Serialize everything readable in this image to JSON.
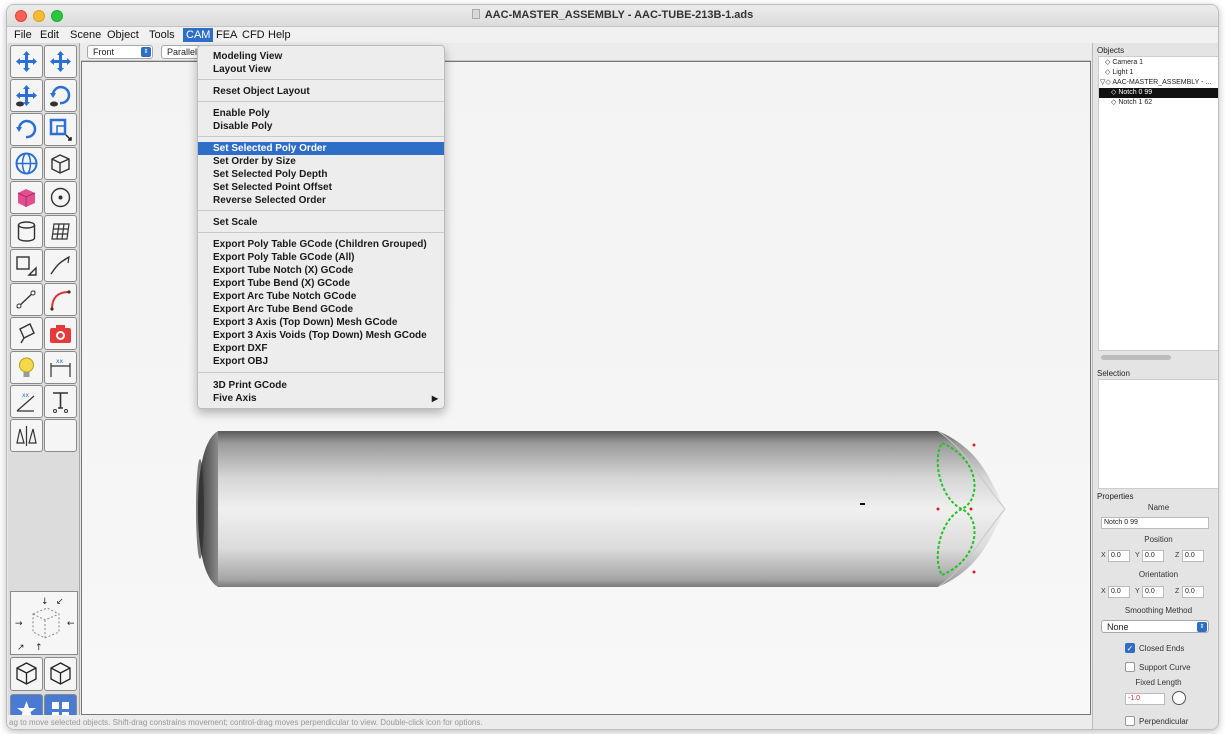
{
  "window": {
    "title": "AAC-MASTER_ASSEMBLY - AAC-TUBE-213B-1.ads"
  },
  "menubar": {
    "items": [
      "File",
      "Edit",
      "Scene",
      "Object",
      "Tools",
      "CAM",
      "FEA",
      "CFD",
      "Help"
    ],
    "active": "CAM"
  },
  "viewbar": {
    "view_select": "Front",
    "projection_select": "Parallel"
  },
  "cam_menu": {
    "groups": [
      [
        "Modeling View",
        "Layout View"
      ],
      [
        "Reset Object Layout"
      ],
      [
        "Enable Poly",
        "Disable Poly"
      ],
      [
        "Set Selected Poly Order",
        "Set Order by Size",
        "Set Selected Poly Depth",
        "Set Selected Point Offset",
        "Reverse Selected Order"
      ],
      [
        "Set Scale"
      ],
      [
        "Export Poly Table GCode (Children Grouped)",
        "Export Poly Table GCode (All)",
        "Export Tube Notch (X) GCode",
        "Export Tube Bend (X) GCode",
        "Export Arc Tube Notch GCode",
        "Export Arc Tube Bend GCode",
        "Export 3 Axis (Top Down) Mesh GCode",
        "Export 3 Axis Voids (Top Down) Mesh GCode",
        "Export DXF",
        "Export OBJ"
      ],
      [
        "3D Print GCode",
        "Five Axis"
      ]
    ],
    "highlighted": "Set Selected Poly Order",
    "submenu_item": "Five Axis"
  },
  "right_panel": {
    "objects_header": "Objects",
    "objects": [
      {
        "label": "Camera 1",
        "indent": 1,
        "selected": false
      },
      {
        "label": "Light 1",
        "indent": 1,
        "selected": false
      },
      {
        "label": "AAC-MASTER_ASSEMBLY - ...",
        "indent": 0,
        "selected": false
      },
      {
        "label": "Notch 0 99",
        "indent": 2,
        "selected": true
      },
      {
        "label": "Notch 1 62",
        "indent": 2,
        "selected": false
      }
    ],
    "selection_header": "Selection",
    "properties_header": "Properties",
    "name_label": "Name",
    "name_value": "Notch 0 99",
    "position_label": "Position",
    "position": {
      "x": "0.0",
      "y": "0.0",
      "z": "0.0"
    },
    "orientation_label": "Orientation",
    "orientation": {
      "x": "0.0",
      "y": "0.0",
      "z": "0.0"
    },
    "smoothing_label": "Smoothing Method",
    "smoothing_value": "None",
    "closed_ends_label": "Closed Ends",
    "closed_ends": true,
    "support_curve_label": "Support Curve",
    "support_curve": false,
    "fixed_length_label": "Fixed Length",
    "fixed_length_value": "-1.0",
    "perpendicular_label": "Perpendicular",
    "perpendicular": false
  },
  "status_bar": "ag to move selected objects. Shift-drag constrains movement; control-drag moves perpendicular to view. Double-click icon for options.",
  "colors": {
    "accent": "#2f6ec7",
    "notch_curve": "#22c322",
    "point_marker": "#e02020"
  }
}
